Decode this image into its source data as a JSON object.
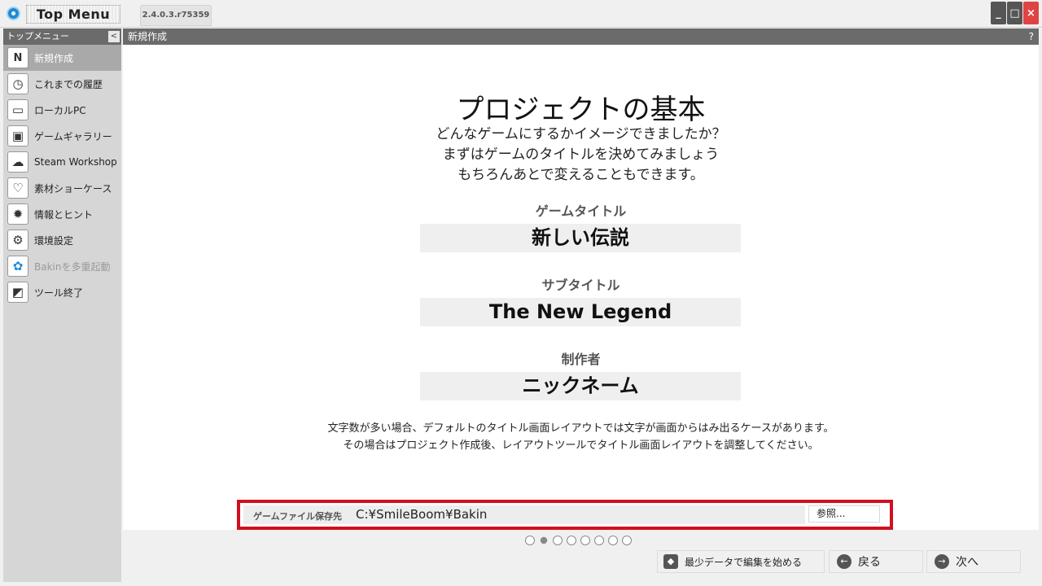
{
  "app": {
    "title": "Top Menu",
    "version": "2.4.0.3.r75359"
  },
  "window_controls": {
    "minimize": "_",
    "maximize": "□",
    "close": "×"
  },
  "sidebar": {
    "header": "トップメニュー",
    "collapse_glyph": "<",
    "items": [
      {
        "label": "新規作成",
        "icon": "N"
      },
      {
        "label": "これまでの履歴",
        "icon": "◷"
      },
      {
        "label": "ローカルPC",
        "icon": "▭"
      },
      {
        "label": "ゲームギャラリー",
        "icon": "▣"
      },
      {
        "label": "Steam Workshop",
        "icon": "☁"
      },
      {
        "label": "素材ショーケース",
        "icon": "♡"
      },
      {
        "label": "情報とヒント",
        "icon": "✹"
      },
      {
        "label": "環境設定",
        "icon": "⚙"
      },
      {
        "label": "Bakinを多重起動",
        "icon": "✿"
      },
      {
        "label": "ツール終了",
        "icon": "◩"
      }
    ]
  },
  "content": {
    "header": "新規作成",
    "help": "?",
    "main_title": "プロジェクトの基本",
    "intro_lines": [
      "どんなゲームにするかイメージできましたか？",
      "まずはゲームのタイトルを決めてみましょう",
      "もちろんあとで変えることもできます。"
    ],
    "fields": {
      "game_title_label": "ゲームタイトル",
      "game_title_value": "新しい伝説",
      "subtitle_label": "サブタイトル",
      "subtitle_value": "The New Legend",
      "author_label": "制作者",
      "author_value": "ニックネーム"
    },
    "note_lines": [
      "文字数が多い場合、デフォルトのタイトル画面レイアウトでは文字が画面からはみ出るケースがあります。",
      "その場合はプロジェクト作成後、レイアウトツールでタイトル画面レイアウトを調整してください。"
    ],
    "save": {
      "label": "ゲームファイル保存先",
      "path": "C:¥SmileBoom¥Bakin",
      "browse": "参照..."
    }
  },
  "pager": {
    "total": 8,
    "current": 1
  },
  "footer": {
    "minimal_data_button": "最少データで編集を始める",
    "back_button": "戻る",
    "next_button": "次へ"
  }
}
